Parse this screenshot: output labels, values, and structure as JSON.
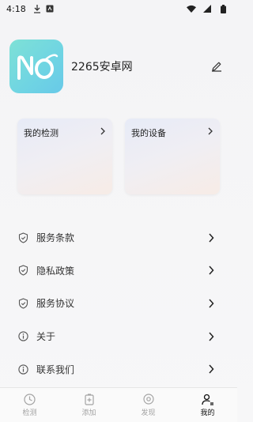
{
  "status_bar": {
    "time": "4:18",
    "icons": [
      "download-icon",
      "keyboard-icon",
      "wifi-icon",
      "signal-icon",
      "battery-icon"
    ]
  },
  "profile": {
    "name": "2265安卓网",
    "avatar_logo": "no",
    "edit_icon": "pencil-icon"
  },
  "cards": [
    {
      "label": "我的检测"
    },
    {
      "label": "我的设备"
    }
  ],
  "menu": [
    {
      "label": "服务条款",
      "icon": "shield-check-icon"
    },
    {
      "label": "隐私政策",
      "icon": "shield-check-icon"
    },
    {
      "label": "服务协议",
      "icon": "shield-check-icon"
    },
    {
      "label": "关于",
      "icon": "info-icon"
    },
    {
      "label": "联系我们",
      "icon": "info-icon"
    }
  ],
  "bottom_nav": [
    {
      "label": "检测",
      "icon": "detect-icon",
      "active": false
    },
    {
      "label": "添加",
      "icon": "add-icon",
      "active": false
    },
    {
      "label": "发现",
      "icon": "discover-icon",
      "active": false
    },
    {
      "label": "我的",
      "icon": "profile-icon",
      "active": true
    }
  ],
  "colors": {
    "avatar_gradient": [
      "#7ee1d6",
      "#68c9e8"
    ],
    "nav_active": "#111111",
    "nav_inactive": "#a3a3a3"
  }
}
